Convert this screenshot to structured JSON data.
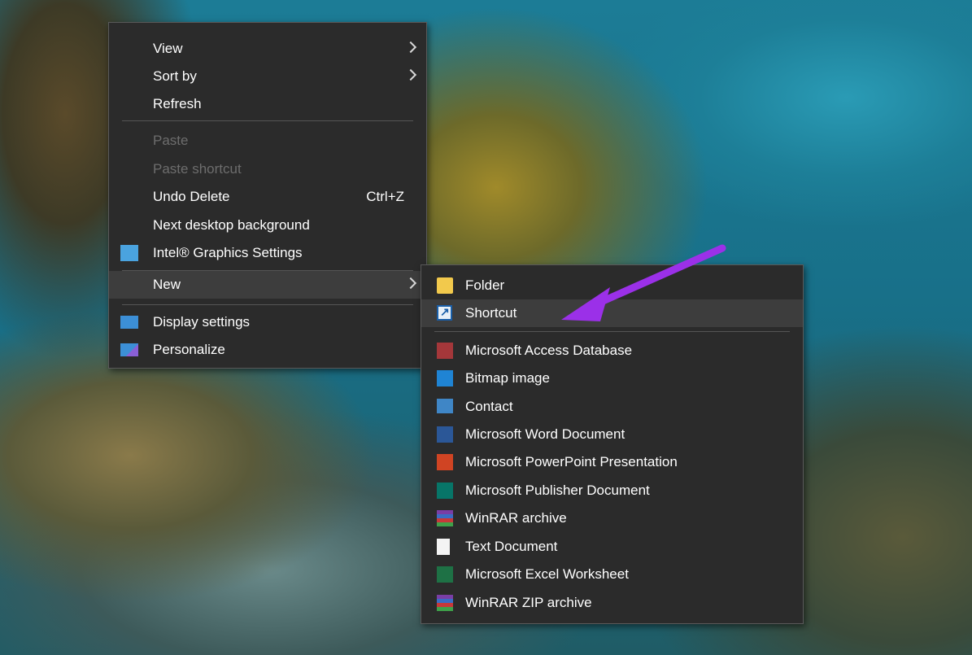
{
  "context_menu": {
    "items": [
      {
        "label": "View",
        "has_submenu": true
      },
      {
        "label": "Sort by",
        "has_submenu": true
      },
      {
        "label": "Refresh"
      },
      {
        "label": "Paste",
        "disabled": true
      },
      {
        "label": "Paste shortcut",
        "disabled": true
      },
      {
        "label": "Undo Delete",
        "shortcut": "Ctrl+Z"
      },
      {
        "label": "Next desktop background"
      },
      {
        "label": "Intel® Graphics Settings",
        "icon": "intel-graphics-icon"
      },
      {
        "label": "New",
        "has_submenu": true,
        "highlighted": true
      },
      {
        "label": "Display settings",
        "icon": "display-icon"
      },
      {
        "label": "Personalize",
        "icon": "personalize-icon"
      }
    ]
  },
  "new_submenu": {
    "items": [
      {
        "label": "Folder",
        "icon": "folder-icon"
      },
      {
        "label": "Shortcut",
        "icon": "shortcut-icon",
        "highlighted": true
      },
      {
        "label": "Microsoft Access Database",
        "icon": "access-icon"
      },
      {
        "label": "Bitmap image",
        "icon": "bitmap-icon"
      },
      {
        "label": "Contact",
        "icon": "contact-icon"
      },
      {
        "label": "Microsoft Word Document",
        "icon": "word-icon"
      },
      {
        "label": "Microsoft PowerPoint Presentation",
        "icon": "powerpoint-icon"
      },
      {
        "label": "Microsoft Publisher Document",
        "icon": "publisher-icon"
      },
      {
        "label": "WinRAR archive",
        "icon": "winrar-icon"
      },
      {
        "label": "Text Document",
        "icon": "text-document-icon"
      },
      {
        "label": "Microsoft Excel Worksheet",
        "icon": "excel-icon"
      },
      {
        "label": "WinRAR ZIP archive",
        "icon": "winrar-zip-icon"
      }
    ]
  },
  "colors": {
    "menu_background": "#2b2b2b",
    "menu_highlight": "#3d3d3d",
    "annotation_arrow": "#9b30e8"
  }
}
